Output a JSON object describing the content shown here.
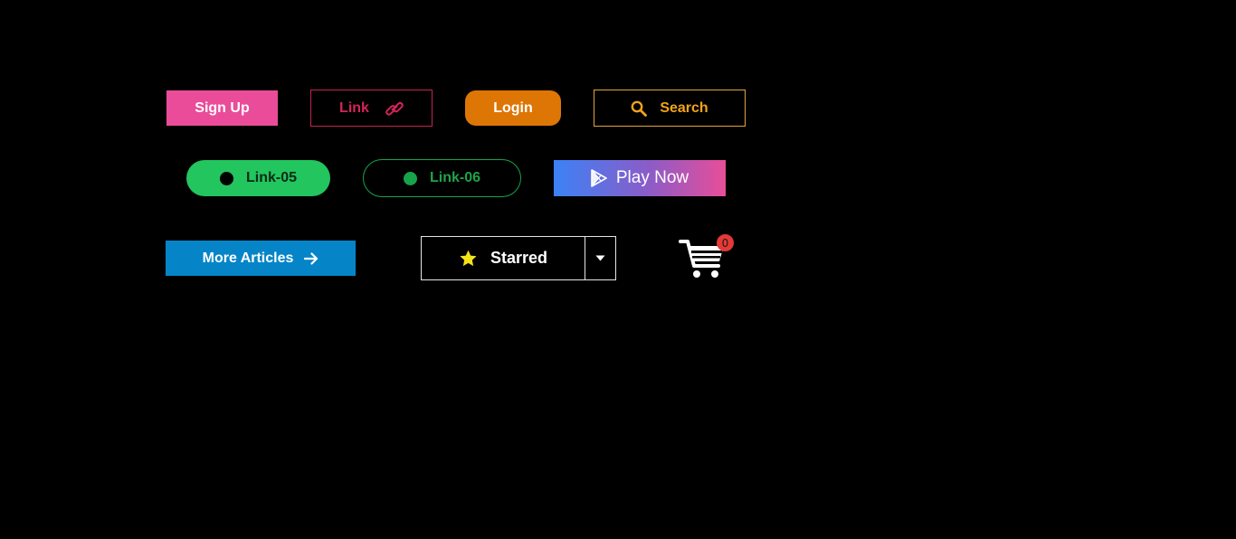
{
  "buttons": {
    "signup": {
      "label": "Sign Up"
    },
    "link": {
      "label": "Link",
      "icon": "link-icon"
    },
    "login": {
      "label": "Login"
    },
    "search": {
      "label": "Search",
      "icon": "search-icon"
    },
    "link05": {
      "label": "Link-05",
      "icon": "dot-icon"
    },
    "link06": {
      "label": "Link-06",
      "icon": "dot-icon"
    },
    "play": {
      "label": "Play Now",
      "icon": "play-store-icon"
    },
    "more_articles": {
      "label": "More Articles",
      "icon": "arrow-right-icon"
    },
    "starred": {
      "label": "Starred",
      "icon": "star-icon",
      "dropdown_icon": "caret-down-icon"
    }
  },
  "cart": {
    "icon": "shopping-cart-icon",
    "count": "0"
  },
  "colors": {
    "background": "#000000",
    "signup": "#ea4c9a",
    "link": "#d1245a",
    "login": "#de7606",
    "search": "#f2a31a",
    "green": "#22c55e",
    "more_articles": "#0585c8",
    "star": "#f5e31a",
    "badge": "#e53935"
  }
}
